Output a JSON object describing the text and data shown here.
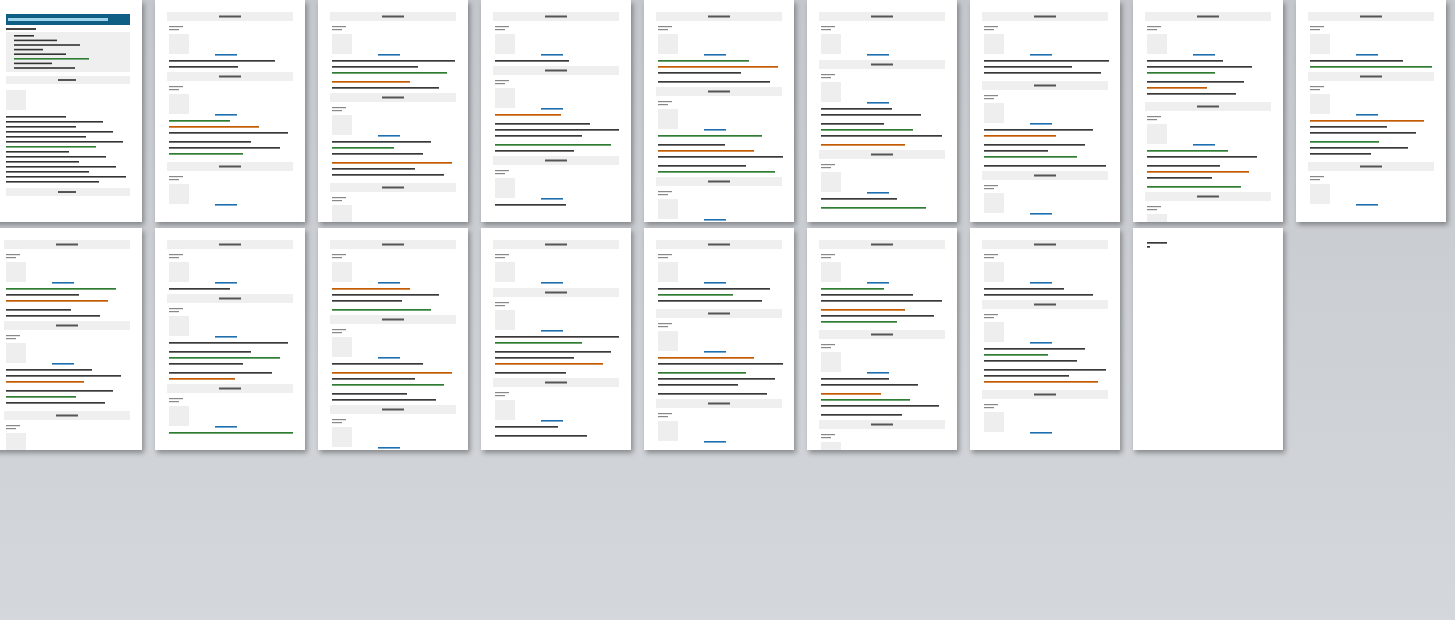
{
  "document_pages": [
    {
      "kind": "cover"
    },
    {
      "kind": "page"
    },
    {
      "kind": "page"
    },
    {
      "kind": "page"
    },
    {
      "kind": "page"
    },
    {
      "kind": "page"
    },
    {
      "kind": "page"
    },
    {
      "kind": "page"
    },
    {
      "kind": "page"
    },
    {
      "kind": "page"
    },
    {
      "kind": "page"
    },
    {
      "kind": "page"
    },
    {
      "kind": "page"
    },
    {
      "kind": "page"
    },
    {
      "kind": "page"
    },
    {
      "kind": "page"
    },
    {
      "kind": "end"
    }
  ]
}
